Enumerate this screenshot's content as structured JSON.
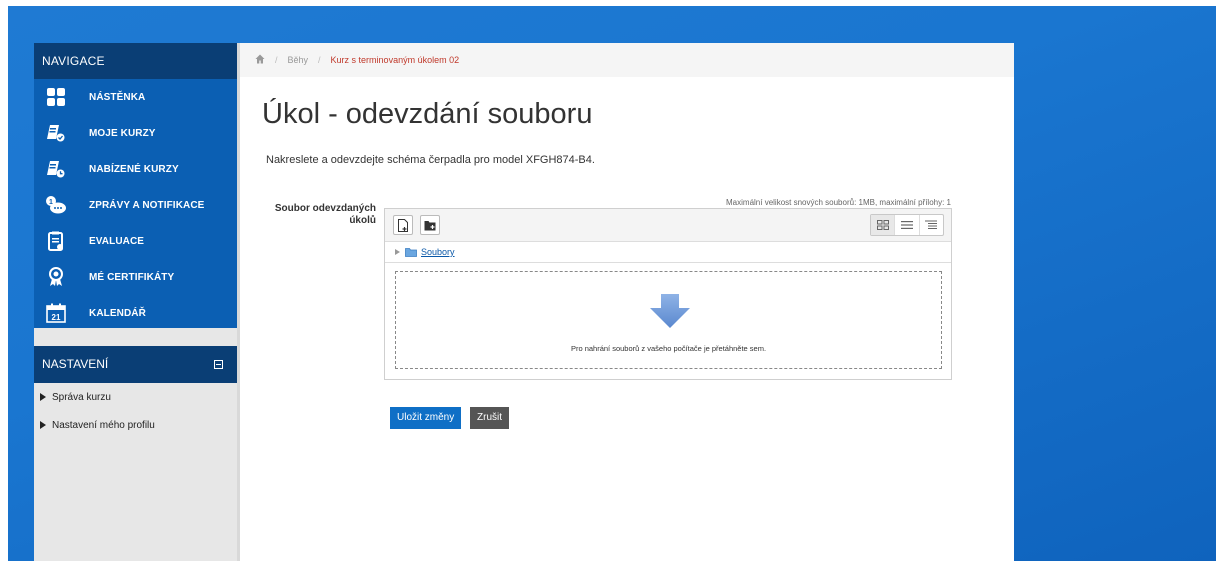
{
  "navigation": {
    "header": "NAVIGACE",
    "items": [
      {
        "label": "NÁSTĚNKA",
        "icon": "dashboard-icon"
      },
      {
        "label": "MOJE KURZY",
        "icon": "my-courses-icon"
      },
      {
        "label": "NABÍZENÉ KURZY",
        "icon": "offered-courses-icon"
      },
      {
        "label": "ZPRÁVY A NOTIFIKACE",
        "icon": "messages-icon"
      },
      {
        "label": "EVALUACE",
        "icon": "evaluation-icon"
      },
      {
        "label": "MÉ CERTIFIKÁTY",
        "icon": "certificate-icon"
      },
      {
        "label": "KALENDÁŘ",
        "icon": "calendar-icon",
        "day": "21"
      }
    ]
  },
  "settings": {
    "header": "NASTAVENÍ",
    "items": [
      {
        "label": "Správa kurzu"
      },
      {
        "label": "Nastavení mého profilu"
      }
    ]
  },
  "breadcrumb": {
    "items": [
      "Běhy",
      "Kurz s terminovaným úkolem 02"
    ],
    "separator": "/"
  },
  "page": {
    "title": "Úkol - odevzdání souboru",
    "intro": "Nakreslete a odevzdejte schéma čerpadla pro model XFGH874-B4.",
    "max_info": "Maximální velikost snových souborů: 1MB, maximální přílohy: 1",
    "field_label": "Soubor odevzdaných úkolů"
  },
  "filemanager": {
    "path_label": "Soubory",
    "drop_text": "Pro nahrání souborů z vašeho počítače je přetáhněte sem."
  },
  "buttons": {
    "save": "Uložit změny",
    "cancel": "Zrušit"
  },
  "colors": {
    "nav_bg": "#0b5fb3",
    "nav_header": "#0a3e75",
    "accent": "#0f6fc6",
    "breadcrumb_active": "#c0392b"
  }
}
